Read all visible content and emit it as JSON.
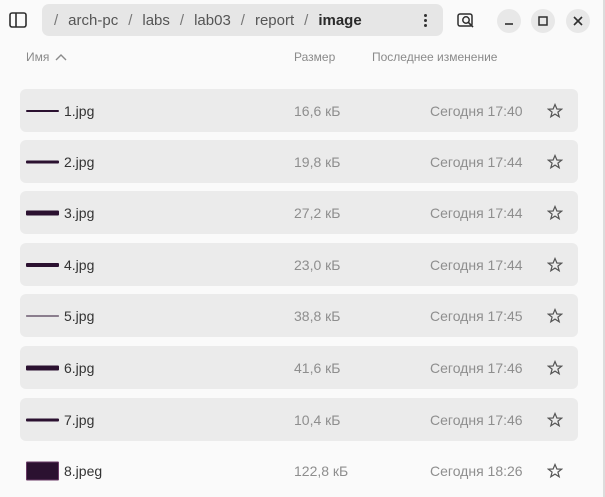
{
  "path": {
    "crumbs": [
      "arch-pc",
      "labs",
      "lab03",
      "report",
      "image"
    ],
    "separator": "/"
  },
  "columns": {
    "name": "Имя",
    "size": "Размер",
    "modified": "Последнее изменение"
  },
  "files": [
    {
      "name": "1.jpg",
      "size": "16,6 кБ",
      "modified": "Сегодня 17:40"
    },
    {
      "name": "2.jpg",
      "size": "19,8 кБ",
      "modified": "Сегодня 17:44"
    },
    {
      "name": "3.jpg",
      "size": "27,2 кБ",
      "modified": "Сегодня 17:44"
    },
    {
      "name": "4.jpg",
      "size": "23,0 кБ",
      "modified": "Сегодня 17:44"
    },
    {
      "name": "5.jpg",
      "size": "38,8 кБ",
      "modified": "Сегодня 17:45"
    },
    {
      "name": "6.jpg",
      "size": "41,6 кБ",
      "modified": "Сегодня 17:46"
    },
    {
      "name": "7.jpg",
      "size": "10,4 кБ",
      "modified": "Сегодня 17:46"
    },
    {
      "name": "8.jpeg",
      "size": "122,8 кБ",
      "modified": "Сегодня 18:26"
    }
  ],
  "icons": {
    "sidebar": "sidebar-toggle-icon",
    "path_menu": "vertical-dots-icon",
    "search": "search-icon",
    "minimize": "minimize-icon",
    "maximize": "maximize-icon",
    "close": "close-icon",
    "star": "star-icon",
    "sort": "sort-ascending-icon"
  },
  "colors": {
    "thumbnail": "#2b1130",
    "row_background": "#ebebeb",
    "pathbar_background": "#e6e6e6"
  }
}
